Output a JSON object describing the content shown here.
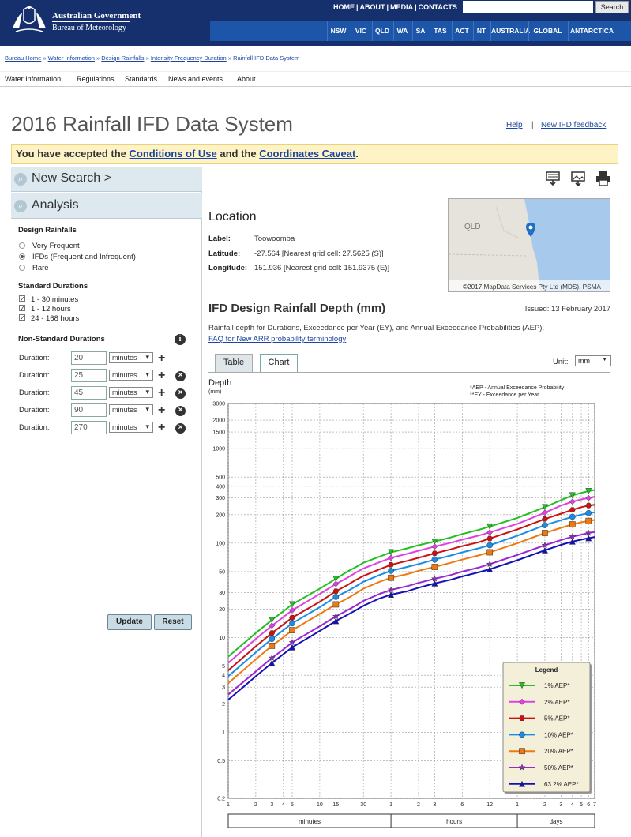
{
  "header": {
    "gov_name": "Australian Government",
    "agency": "Bureau of Meteorology",
    "top_links": [
      "HOME",
      "ABOUT",
      "MEDIA",
      "CONTACTS"
    ],
    "search_label": "Search",
    "states": [
      "NSW",
      "VIC",
      "QLD",
      "WA",
      "SA",
      "TAS",
      "ACT",
      "NT",
      "AUSTRALIA",
      "GLOBAL",
      "ANTARCTICA"
    ]
  },
  "breadcrumb": [
    "Bureau Home",
    "Water Information",
    "Design Rainfalls",
    "Intensity Frequency Duration",
    "Rainfall IFD Data System"
  ],
  "mainnav": [
    "Water Information",
    "Regulations",
    "Standards",
    "News and events",
    "About"
  ],
  "page": {
    "title": "2016 Rainfall IFD Data System",
    "help": "Help",
    "separator": "|",
    "feedback": "New IFD feedback"
  },
  "notice": {
    "prefix": "You have accepted the ",
    "link1": "Conditions of Use",
    "mid": " and the ",
    "link2": "Coordinates Caveat",
    "suffix": "."
  },
  "sidebar": {
    "new_search": "New Search >",
    "analysis": "Analysis",
    "design_rainfalls_title": "Design Rainfalls",
    "design_rainfalls": [
      {
        "label": "Very Frequent",
        "selected": false
      },
      {
        "label": "IFDs (Frequent and Infrequent)",
        "selected": true
      },
      {
        "label": "Rare",
        "selected": false
      }
    ],
    "standard_title": "Standard Durations",
    "standard": [
      {
        "label": "1 - 30 minutes",
        "checked": true
      },
      {
        "label": "1 - 12 hours",
        "checked": true
      },
      {
        "label": "24 - 168 hours",
        "checked": true
      }
    ],
    "nonstandard_title": "Non-Standard Durations",
    "duration_label": "Duration:",
    "durations": [
      {
        "value": "20",
        "unit": "minutes"
      },
      {
        "value": "25",
        "unit": "minutes"
      },
      {
        "value": "45",
        "unit": "minutes"
      },
      {
        "value": "90",
        "unit": "minutes"
      },
      {
        "value": "270",
        "unit": "minutes"
      }
    ],
    "update": "Update",
    "reset": "Reset"
  },
  "location": {
    "title": "Location",
    "label_key": "Label:",
    "label_val": "Toowoomba",
    "lat_key": "Latitude:",
    "lat_val": "-27.564 [Nearest grid cell: 27.5625 (S)]",
    "lon_key": "Longitude:",
    "lon_val": "151.936 [Nearest grid cell: 151.9375 (E)]",
    "map_region": "QLD",
    "map_credit": "©2017 MapData Services Pty Ltd (MDS), PSMA"
  },
  "ifd": {
    "title": "IFD Design Rainfall Depth (mm)",
    "issued": "Issued: 13 February 2017",
    "desc": "Rainfall depth for Durations, Exceedance per Year (EY), and Annual Exceedance Probabilities (AEP).",
    "faq": "FAQ for New ARR probability terminology",
    "tabs": [
      "Table",
      "Chart"
    ],
    "unit_label": "Unit:",
    "unit": "mm"
  },
  "chart_data": {
    "type": "line",
    "ylabel": "Depth",
    "yunit": "(mm)",
    "notes": [
      "*AEP - Annual Exceedance Probability",
      "**EY - Exceedance per Year"
    ],
    "y_scale": "log",
    "ylim": [
      0.2,
      3000
    ],
    "y_ticks": [
      "0.2",
      "0.5",
      "1",
      "2",
      "3",
      "4",
      "5",
      "10",
      "20",
      "30",
      "50",
      "100",
      "200",
      "300",
      "400",
      "500",
      "1000",
      "1500",
      "2000",
      "3000"
    ],
    "x_scale": "log",
    "x_unit": "minutes",
    "xlim": [
      1,
      10080
    ],
    "x_ticks": [
      "1",
      "2",
      "3",
      "4",
      "5",
      "10",
      "15",
      "30",
      "1",
      "2",
      "3",
      "6",
      "12",
      "1",
      "2",
      "3",
      "4",
      "5",
      "6",
      "7"
    ],
    "x_groups": [
      "minutes",
      "hours",
      "days"
    ],
    "x": [
      1,
      2,
      3,
      4,
      5,
      10,
      15,
      20,
      25,
      30,
      45,
      60,
      90,
      120,
      180,
      270,
      360,
      540,
      720,
      1440,
      2880,
      4320,
      5760,
      7200,
      8640,
      10080
    ],
    "marker_x": [
      3,
      5,
      15,
      60,
      180,
      720,
      2880,
      5760,
      8640
    ],
    "legend_title": "Legend",
    "legend_position": "bottom-right",
    "grid": true,
    "series": [
      {
        "name": "1% AEP*",
        "color": "#22c020",
        "marker": "tri-down",
        "values": [
          6.3,
          11.2,
          15.4,
          19,
          22.5,
          33,
          42,
          50,
          56,
          62,
          72,
          80,
          88,
          95,
          104,
          115,
          125,
          138,
          150,
          185,
          240,
          285,
          320,
          340,
          355,
          365
        ]
      },
      {
        "name": "2% AEP*",
        "color": "#e040e0",
        "marker": "diamond",
        "values": [
          5.4,
          9.7,
          13.4,
          16.5,
          19.5,
          29,
          37,
          43,
          49,
          54,
          63,
          70,
          77,
          83,
          92,
          101,
          109,
          120,
          130,
          160,
          210,
          250,
          275,
          290,
          300,
          310
        ]
      },
      {
        "name": "5% AEP*",
        "color": "#cc1010",
        "marker": "hexagon",
        "values": [
          4.5,
          8.1,
          11.2,
          13.8,
          16.3,
          24,
          31,
          36,
          41,
          45,
          53,
          59,
          65,
          70,
          78,
          86,
          93,
          102,
          112,
          140,
          180,
          205,
          225,
          240,
          250,
          255
        ]
      },
      {
        "name": "10% AEP*",
        "color": "#1a8ce8",
        "marker": "circle",
        "values": [
          3.9,
          7,
          9.7,
          12,
          14.2,
          21,
          27,
          31,
          35,
          39,
          46,
          51,
          56,
          60,
          67,
          74,
          80,
          88,
          95,
          120,
          155,
          175,
          190,
          200,
          208,
          212
        ]
      },
      {
        "name": "20% AEP*",
        "color": "#f07810",
        "marker": "square",
        "values": [
          3.3,
          5.9,
          8.2,
          10.1,
          12,
          17.8,
          22.5,
          26,
          29.5,
          33,
          39,
          43,
          47,
          51,
          56,
          62,
          67,
          74,
          80,
          100,
          128,
          145,
          158,
          166,
          172,
          176
        ]
      },
      {
        "name": "50% AEP*",
        "color": "#9a28d0",
        "marker": "star",
        "values": [
          2.5,
          4.4,
          6.1,
          7.5,
          8.9,
          13.2,
          16.8,
          19.5,
          22,
          24.5,
          29,
          32,
          35,
          38,
          42,
          46,
          50,
          55,
          60,
          75,
          95,
          108,
          117,
          123,
          128,
          131
        ]
      },
      {
        "name": "63.2% AEP*",
        "color": "#1410b8",
        "marker": "tri-up",
        "values": [
          2.2,
          3.9,
          5.4,
          6.7,
          7.9,
          11.8,
          15,
          17.4,
          19.6,
          21.8,
          26,
          28.5,
          31,
          33.8,
          37.5,
          41,
          44.5,
          49,
          53,
          66,
          84,
          96,
          104,
          109,
          113,
          116
        ]
      }
    ]
  }
}
